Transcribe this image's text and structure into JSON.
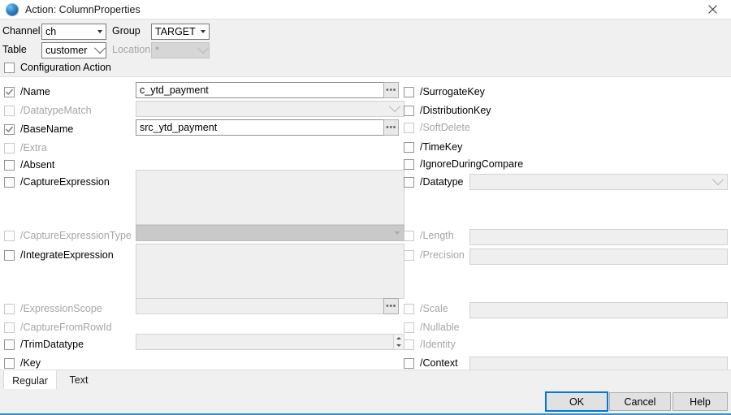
{
  "window": {
    "title": "Action: ColumnProperties",
    "icon": "globe-icon",
    "close_label": "✕",
    "accent_color": "#3a8fc4"
  },
  "header": {
    "channel_label": "Channel",
    "channel_value": "ch",
    "group_label": "Group",
    "group_value": "TARGET",
    "table_label": "Table",
    "table_value": "customer",
    "location_label": "Location",
    "location_value": "*",
    "configuration_action_label": "Configuration Action",
    "configuration_action_checked": false
  },
  "left_fields": [
    {
      "label": "/Name",
      "checked": true,
      "enabled": true,
      "control": "text",
      "value": "c_ytd_payment",
      "browse": true
    },
    {
      "label": "/DatatypeMatch",
      "checked": false,
      "enabled": false,
      "control": "combo-ro",
      "value": "",
      "browse": false
    },
    {
      "label": "/BaseName",
      "checked": true,
      "enabled": true,
      "control": "text",
      "value": "src_ytd_payment",
      "browse": true
    },
    {
      "label": "/Extra",
      "checked": false,
      "enabled": false,
      "control": "none",
      "value": "",
      "browse": false
    },
    {
      "label": "/Absent",
      "checked": false,
      "enabled": true,
      "control": "none",
      "value": "",
      "browse": false
    },
    {
      "label": "/CaptureExpression",
      "checked": false,
      "enabled": true,
      "control": "textarea",
      "value": "",
      "browse": false
    },
    {
      "label": "/CaptureExpressionType",
      "checked": false,
      "enabled": false,
      "control": "combo-dis",
      "value": "",
      "browse": false
    },
    {
      "label": "/IntegrateExpression",
      "checked": false,
      "enabled": true,
      "control": "textarea",
      "value": "",
      "browse": false
    },
    {
      "label": "/ExpressionScope",
      "checked": false,
      "enabled": false,
      "control": "text-ro",
      "value": "",
      "browse": true
    },
    {
      "label": "/CaptureFromRowId",
      "checked": false,
      "enabled": false,
      "control": "none",
      "value": "",
      "browse": false
    },
    {
      "label": "/TrimDatatype",
      "checked": false,
      "enabled": true,
      "control": "spinner",
      "value": "",
      "browse": false
    },
    {
      "label": "/Key",
      "checked": false,
      "enabled": true,
      "control": "none",
      "value": "",
      "browse": false
    }
  ],
  "right_fields": [
    {
      "label": "/SurrogateKey",
      "checked": false,
      "enabled": true,
      "control": "none",
      "value": ""
    },
    {
      "label": "/DistributionKey",
      "checked": false,
      "enabled": true,
      "control": "none",
      "value": ""
    },
    {
      "label": "/SoftDelete",
      "checked": false,
      "enabled": false,
      "control": "none",
      "value": ""
    },
    {
      "label": "/TimeKey",
      "checked": false,
      "enabled": true,
      "control": "none",
      "value": ""
    },
    {
      "label": "/IgnoreDuringCompare",
      "checked": false,
      "enabled": true,
      "control": "none",
      "value": ""
    },
    {
      "label": "/Datatype",
      "checked": false,
      "enabled": true,
      "control": "combo-ro",
      "value": ""
    },
    {
      "label": "/Length",
      "checked": false,
      "enabled": false,
      "control": "text-ro",
      "value": ""
    },
    {
      "label": "/Precision",
      "checked": false,
      "enabled": false,
      "control": "text-ro",
      "value": ""
    },
    {
      "label": "/Scale",
      "checked": false,
      "enabled": false,
      "control": "text-ro",
      "value": ""
    },
    {
      "label": "/Nullable",
      "checked": false,
      "enabled": false,
      "control": "none",
      "value": ""
    },
    {
      "label": "/Identity",
      "checked": false,
      "enabled": false,
      "control": "none",
      "value": ""
    },
    {
      "label": "/Context",
      "checked": false,
      "enabled": true,
      "control": "text-ro",
      "value": ""
    }
  ],
  "tabs": [
    {
      "label": "Regular",
      "active": true
    },
    {
      "label": "Text",
      "active": false
    }
  ],
  "buttons": {
    "ok": "OK",
    "cancel": "Cancel",
    "help": "Help"
  }
}
